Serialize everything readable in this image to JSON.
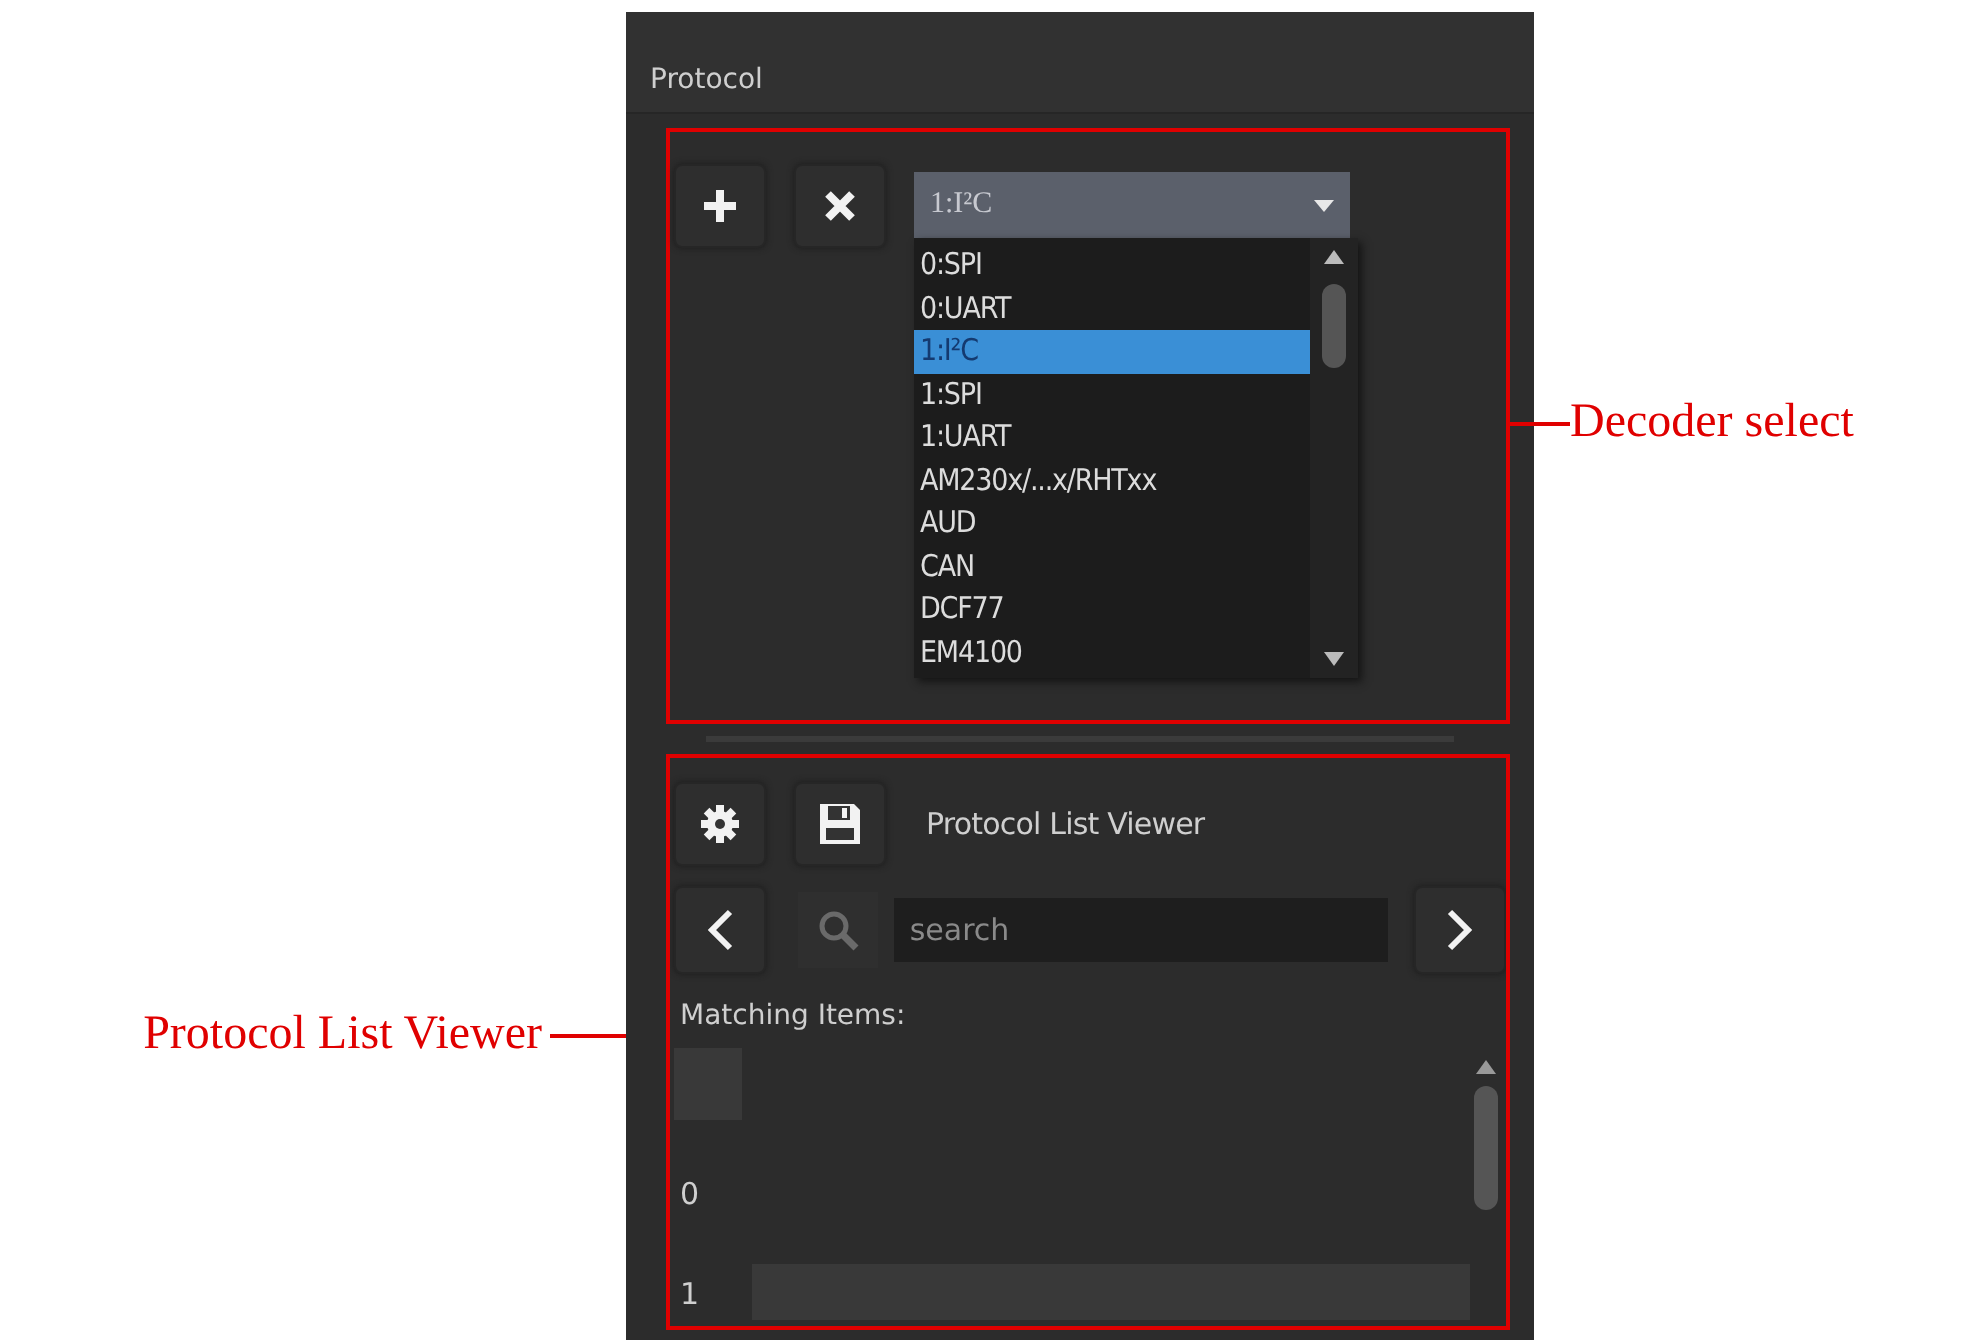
{
  "panel": {
    "title": "Protocol"
  },
  "decoder_select": {
    "value": "1:I²C",
    "options": [
      {
        "label": "0:SPI",
        "selected": false
      },
      {
        "label": "0:UART",
        "selected": false
      },
      {
        "label": "1:I²C",
        "selected": true
      },
      {
        "label": "1:SPI",
        "selected": false
      },
      {
        "label": "1:UART",
        "selected": false
      },
      {
        "label": "AM230x/...x/RHTxx",
        "selected": false
      },
      {
        "label": "AUD",
        "selected": false
      },
      {
        "label": "CAN",
        "selected": false
      },
      {
        "label": "DCF77",
        "selected": false
      },
      {
        "label": "EM4100",
        "selected": false
      }
    ]
  },
  "list_viewer": {
    "title": "Protocol List Viewer",
    "search": {
      "placeholder": "search"
    },
    "matching_label": "Matching Items:",
    "rows": [
      {
        "index": "0",
        "highlighted": false
      },
      {
        "index": "1",
        "highlighted": true
      }
    ]
  },
  "callouts": {
    "left": "Protocol List Viewer",
    "right": "Decoder select"
  }
}
